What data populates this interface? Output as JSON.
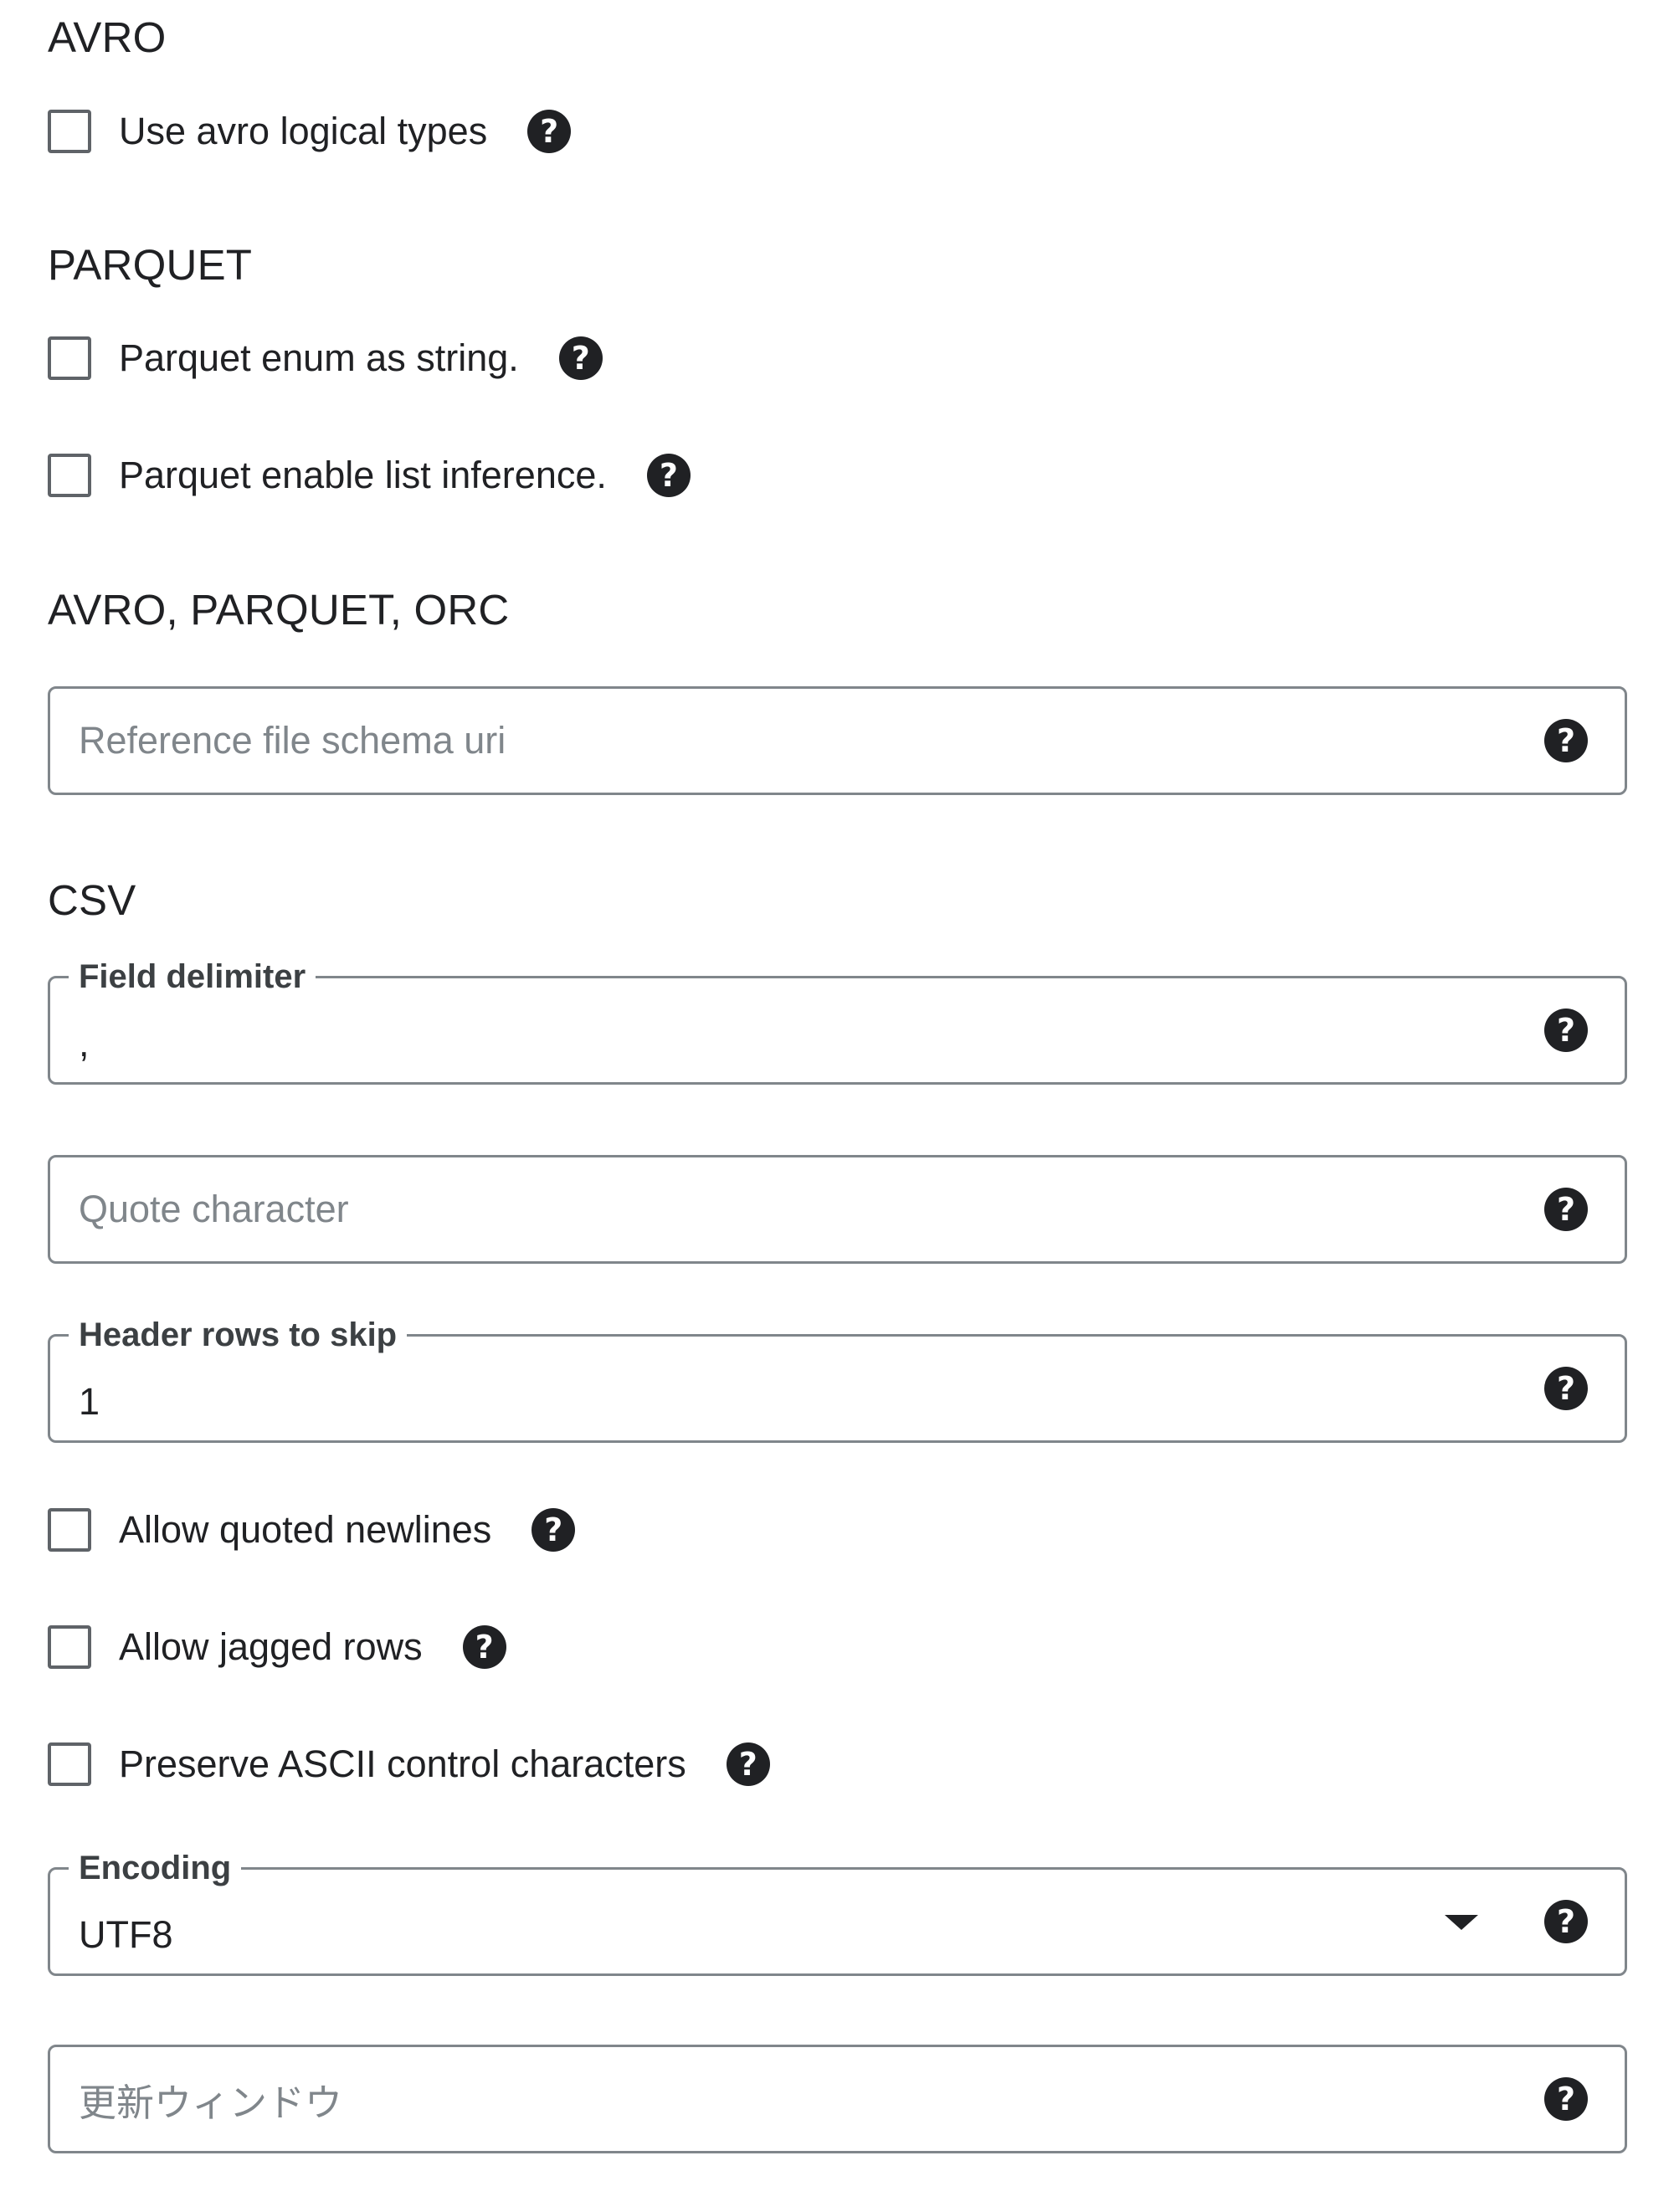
{
  "sections": {
    "avro": {
      "title": "AVRO",
      "use_logical_types": {
        "label": "Use avro logical types",
        "checked": false
      }
    },
    "parquet": {
      "title": "PARQUET",
      "enum_as_string": {
        "label": "Parquet enum as string.",
        "checked": false
      },
      "enable_list_inference": {
        "label": "Parquet enable list inference.",
        "checked": false
      }
    },
    "avro_parquet_orc": {
      "title": "AVRO, PARQUET, ORC",
      "reference_schema_uri": {
        "placeholder": "Reference file schema uri",
        "value": ""
      }
    },
    "csv": {
      "title": "CSV",
      "field_delimiter": {
        "label": "Field delimiter",
        "value": ","
      },
      "quote_character": {
        "placeholder": "Quote character",
        "value": ""
      },
      "header_rows_to_skip": {
        "label": "Header rows to skip",
        "value": "1"
      },
      "allow_quoted_newlines": {
        "label": "Allow quoted newlines",
        "checked": false
      },
      "allow_jagged_rows": {
        "label": "Allow jagged rows",
        "checked": false
      },
      "preserve_ascii_control": {
        "label": "Preserve ASCII control characters",
        "checked": false
      },
      "encoding": {
        "label": "Encoding",
        "value": "UTF8"
      },
      "refresh_window": {
        "placeholder": "更新ウィンドウ",
        "value": ""
      }
    }
  },
  "icons": {
    "help": "help-circle-icon",
    "help_glyph": "?",
    "dropdown": "arrow-drop-down-icon"
  },
  "colors": {
    "text": "#202124",
    "placeholder": "#80868b",
    "border": "#80868b",
    "checkbox_border": "#5f6368",
    "background": "#ffffff"
  }
}
